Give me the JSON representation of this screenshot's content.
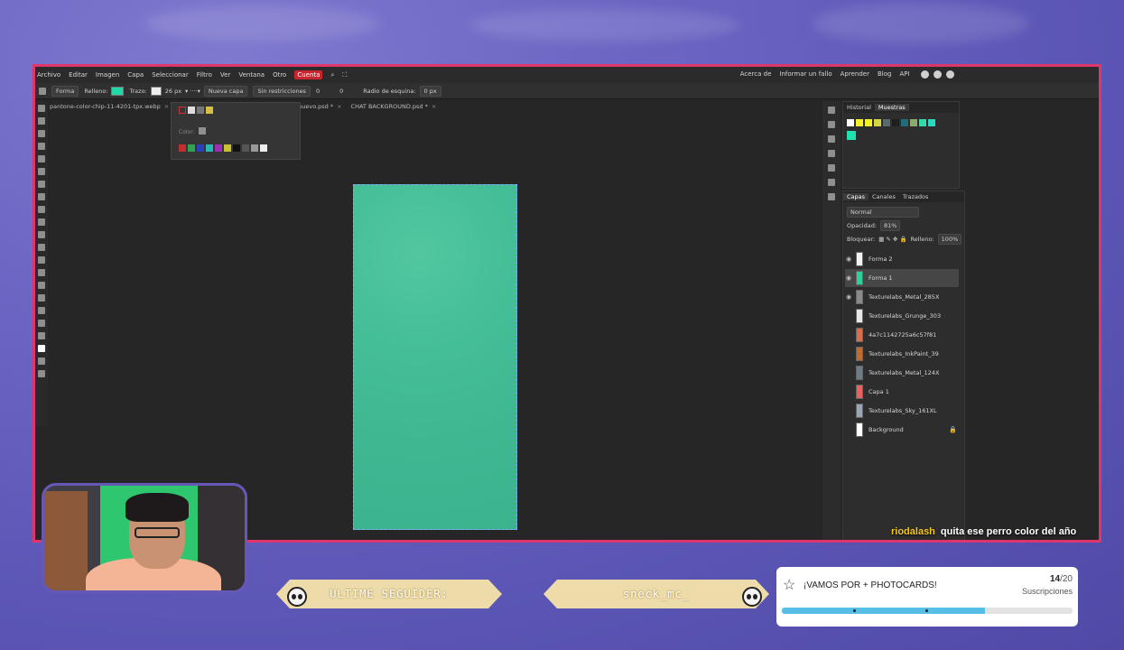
{
  "menu": {
    "items": [
      "Archivo",
      "Editar",
      "Imagen",
      "Capa",
      "Seleccionar",
      "Filtro",
      "Ver",
      "Ventana",
      "Otro",
      "Cuenta"
    ],
    "right_links": [
      "Acerca de",
      "Informar un fallo",
      "Aprender",
      "Blog",
      "API"
    ]
  },
  "options": {
    "tool": "Forma",
    "fill_label": "Relleno:",
    "stroke_label": "Trazo:",
    "stroke_size": "26 px",
    "layer_mode": "Nueva capa",
    "constraint": "Sin restricciones",
    "w_value": "0",
    "h_value": "0",
    "radius_label": "Radio de esquina:",
    "radius_value": "0 px",
    "fill_color": "#23d8a8"
  },
  "tabs": [
    "pantone-color-chip-11-4201-tpx.webp",
    "Nuevo nuevo.psd *",
    "CHAT BACKGROUND.psd *"
  ],
  "color_popup": {
    "label": "Color:"
  },
  "history_panel": {
    "tabs": [
      "Historial",
      "Muestras"
    ],
    "swatches": [
      "#ffffff",
      "#f5f02a",
      "#f5f02a",
      "#d6d640",
      "#556b6e",
      "#1f1f1f",
      "#1e6f7a",
      "#8eaa6c",
      "#38d9a9",
      "#2dd8c0"
    ],
    "selected_swatch": "#23e0b0"
  },
  "layers_panel": {
    "tabs": [
      "Capas",
      "Canales",
      "Trazados"
    ],
    "blend_mode": "Normal",
    "opacity_label": "Opacidad:",
    "opacity_value": "81%",
    "lock_label": "Bloquear:",
    "fill_label": "Relleno:",
    "fill_value": "100%",
    "layers": [
      {
        "name": "Forma 2",
        "visible": true,
        "active": false,
        "thumb": "#f2f2f2"
      },
      {
        "name": "Forma 1",
        "visible": true,
        "active": true,
        "thumb": "#2fcf9b"
      },
      {
        "name": "Texturelabs_Metal_285X",
        "visible": true,
        "active": false,
        "thumb": "#8a8a8a"
      },
      {
        "name": "Texturelabs_Grunge_303",
        "visible": false,
        "active": false,
        "thumb": "#e8e8e8"
      },
      {
        "name": "4a7c1142725a6c57f81",
        "visible": false,
        "active": false,
        "thumb": "#d96c4a"
      },
      {
        "name": "Texturelabs_InkPaint_39",
        "visible": false,
        "active": false,
        "thumb": "#c06a2e"
      },
      {
        "name": "Texturelabs_Metal_124X",
        "visible": false,
        "active": false,
        "thumb": "#6e7b86"
      },
      {
        "name": "Capa 1",
        "visible": false,
        "active": false,
        "thumb": "#e86060"
      },
      {
        "name": "Texturelabs_Sky_161XL",
        "visible": false,
        "active": false,
        "thumb": "#9aa6b3"
      },
      {
        "name": "Background",
        "visible": false,
        "active": false,
        "thumb": "#ffffff",
        "locked": true
      }
    ]
  },
  "chat": {
    "user": "riodalash",
    "message": "quita ese perro color del año"
  },
  "banners": {
    "follower_label": "ÚLTIME SEGUIDER:",
    "follower_name": "sneck_mc_"
  },
  "goal": {
    "title": "¡VAMOS POR + PHOTOCARDS!",
    "current": "14",
    "total": "/20",
    "subtitle": "Suscripciones",
    "progress": 0.7
  }
}
